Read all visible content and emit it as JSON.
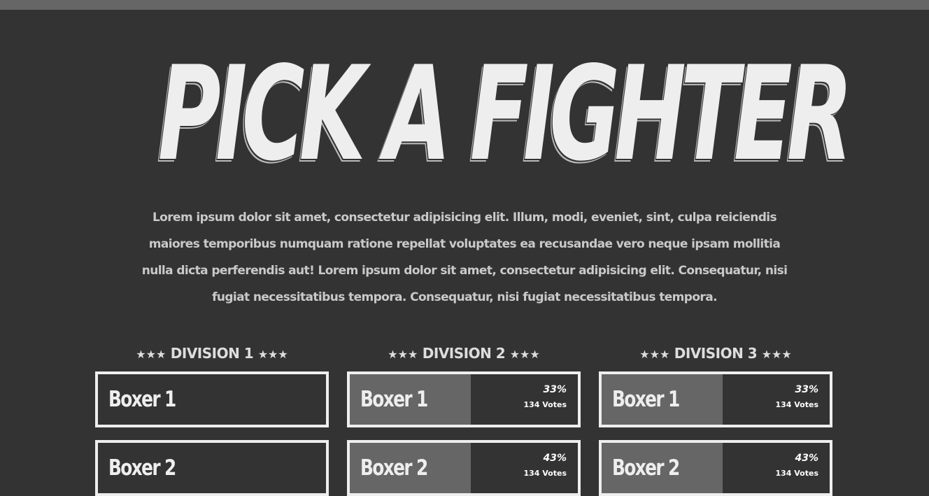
{
  "hero": {
    "title": "PICK A FIGHTER",
    "text": "Lorem ipsum dolor sit amet, consectetur adipisicing elit. Illum, modi, eveniet, sint, culpa reiciendis maiores temporibus numquam ratione repellat voluptates ea recusandae vero neque ipsam mollitia nulla dicta perferendis aut! Lorem ipsum dolor sit amet, consectetur adipisicing elit. Consequatur, nisi fugiat necessitatibus tempora. Consequatur, nisi fugiat necessitatibus tempora."
  },
  "colors": {
    "background": "#333333",
    "top_bar": "#666666",
    "foreground": "#eeeeee",
    "vote_fill": "#666666"
  },
  "divisions": [
    {
      "stars_left": "★★★",
      "label": "DIVISION 1",
      "stars_right": "★★★",
      "boxers": [
        {
          "name": "Boxer 1"
        },
        {
          "name": "Boxer 2"
        }
      ]
    },
    {
      "stars_left": "★★★",
      "label": "DIVISION 2",
      "stars_right": "★★★",
      "boxers": [
        {
          "name": "Boxer 1",
          "percent": "33%",
          "percent_value": 0.53,
          "votes": "134 Votes"
        },
        {
          "name": "Boxer 2",
          "percent": "43%",
          "percent_value": 0.53,
          "votes": "134 Votes"
        }
      ]
    },
    {
      "stars_left": "★★★",
      "label": "DIVISION 3",
      "stars_right": "★★★",
      "boxers": [
        {
          "name": "Boxer 1",
          "percent": "33%",
          "percent_value": 0.53,
          "votes": "134 Votes"
        },
        {
          "name": "Boxer 2",
          "percent": "43%",
          "percent_value": 0.53,
          "votes": "134 Votes"
        }
      ]
    }
  ]
}
